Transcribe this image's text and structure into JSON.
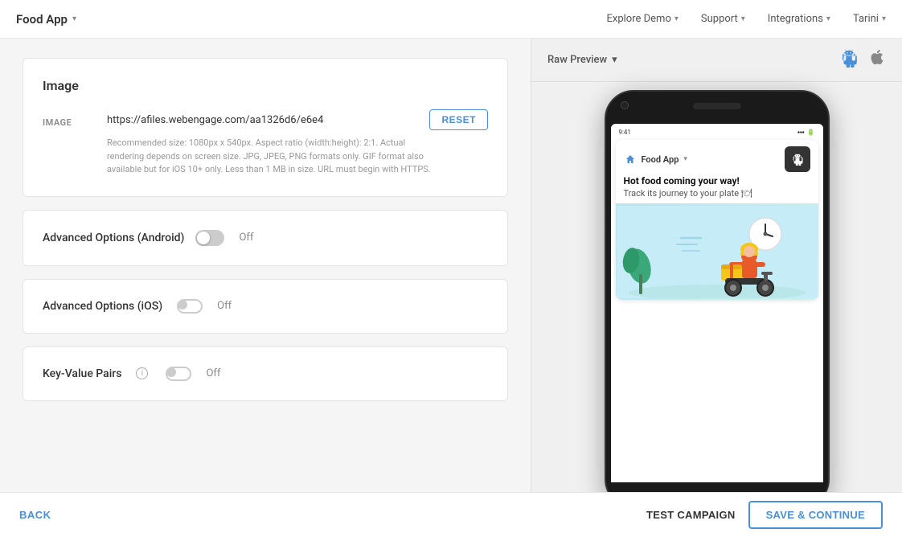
{
  "app": {
    "brand": "Food App",
    "chevron": "▾"
  },
  "nav": {
    "explore_demo": "Explore Demo",
    "support": "Support",
    "integrations": "Integrations",
    "user": "Tarini"
  },
  "left_panel": {
    "image_card": {
      "title": "Image",
      "image_label": "IMAGE",
      "image_url": "https://afiles.webengage.com/aa1326d6/e6e4",
      "reset_label": "RESET",
      "hint": "Recommended size: 1080px x 540px. Aspect ratio (width:height): 2:1. Actual rendering depends on screen size. JPG, JPEG, PNG formats only. GIF format also available but for iOS 10+ only. Less than 1 MB in size. URL must begin with HTTPS."
    },
    "android_options": {
      "title": "Advanced Options (Android)",
      "status": "Off"
    },
    "ios_options": {
      "title": "Advanced Options (iOS)",
      "status": "Off"
    },
    "key_value": {
      "title": "Key-Value Pairs",
      "info": "i",
      "status": "Off"
    }
  },
  "preview": {
    "raw_preview_label": "Raw Preview",
    "chevron": "▾",
    "notification": {
      "app_name": "Food App",
      "title": "Hot food coming your way!",
      "subtitle": "Track its journey to your plate 🍽"
    }
  },
  "bottom": {
    "back_label": "BACK",
    "test_campaign_label": "TEST CAMPAIGN",
    "save_continue_label": "SAVE & CONTINUE"
  }
}
